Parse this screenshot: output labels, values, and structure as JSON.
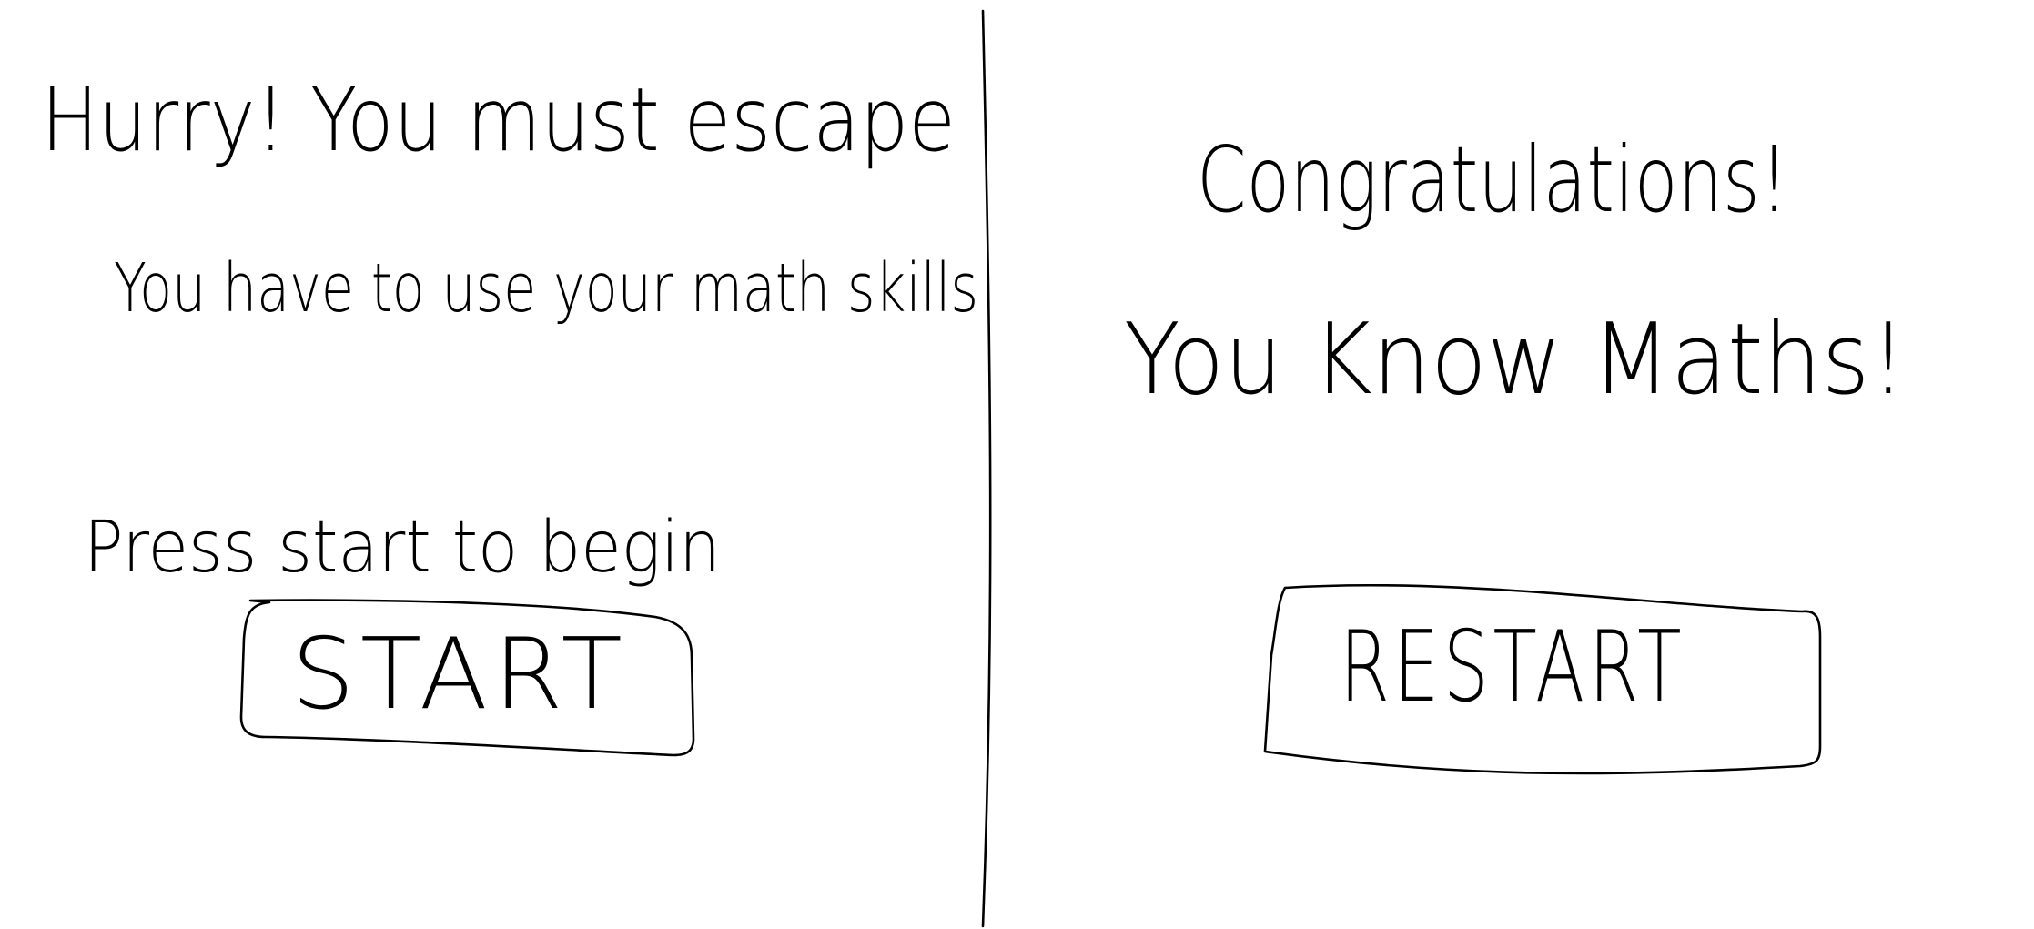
{
  "left_panel": {
    "heading": "Hurry! You must escape",
    "subheading": "You have to use your math skills",
    "instruction": "Press start to begin",
    "start_button": "START"
  },
  "right_panel": {
    "heading": "Congratulations!",
    "subheading": "You Know Maths!",
    "restart_button": "RESTART"
  },
  "colors": {
    "ink": "#000000",
    "background": "#ffffff"
  }
}
